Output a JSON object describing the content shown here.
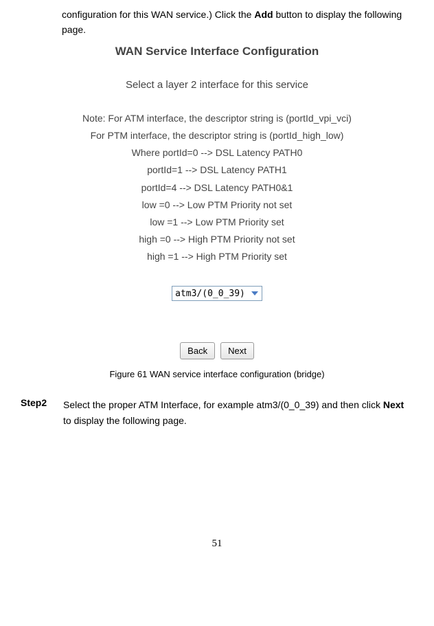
{
  "intro": {
    "prefix": "configuration for this WAN service.) Click the ",
    "add": "Add",
    "suffix": " button to display the following page."
  },
  "panel": {
    "title": "WAN Service Interface Configuration",
    "subtitle": "Select a layer 2 interface for this service",
    "note_lines": [
      "Note: For ATM interface, the descriptor string is (portId_vpi_vci)",
      "For PTM interface, the descriptor string is (portId_high_low)",
      "Where portId=0 --> DSL Latency PATH0",
      "portId=1 --> DSL Latency PATH1",
      "portId=4 --> DSL Latency PATH0&1",
      "low =0 --> Low PTM Priority not set",
      "low =1 --> Low PTM Priority set",
      "high =0 --> High PTM Priority not set",
      "high =1 --> High PTM Priority set"
    ],
    "dropdown_value": "atm3/(0_0_39)",
    "back_label": "Back",
    "next_label": "Next"
  },
  "figure_caption": "Figure 61 WAN service interface configuration (bridge)",
  "step": {
    "label": "Step2",
    "text_prefix": "Select the proper ATM Interface, for example atm3/(0_0_39) and then click ",
    "next": "Next",
    "text_suffix": " to display the following page."
  },
  "page_number": "51"
}
